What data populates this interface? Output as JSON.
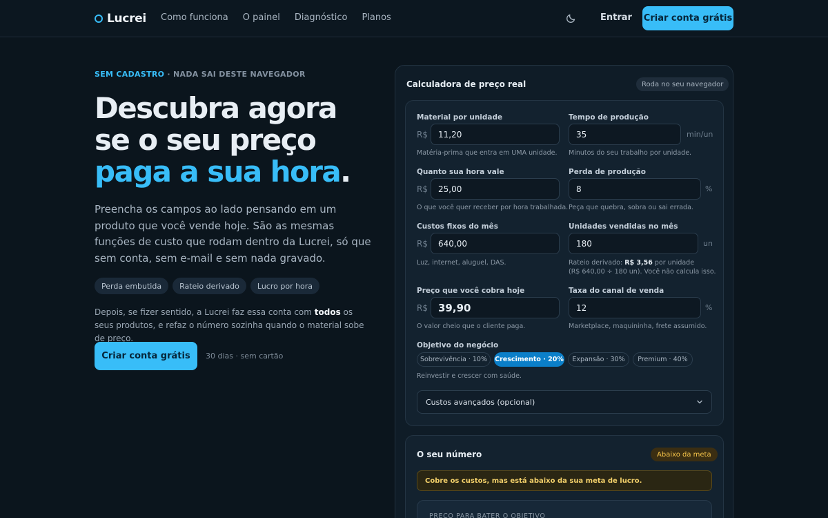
{
  "brand": {
    "name": "Lucrei",
    "accent": "#38bdf8"
  },
  "nav": {
    "links": [
      "Como funciona",
      "O painel",
      "Diagnóstico",
      "Planos"
    ],
    "theme_icon": "moon-icon",
    "login": "Entrar",
    "cta": "Criar conta grátis"
  },
  "hero": {
    "eyebrow_a": "SEM CADASTRO",
    "eyebrow_b": " · NADA SAI DESTE NAVEGADOR",
    "line1": "Descubra agora",
    "line2": "se o seu preço",
    "line3": "paga a sua hora",
    "line3_dot": ".",
    "lead": "Preencha os campos ao lado pensando em um produto que você vende hoje. São as mesmas funções de custo que rodam dentro da Lucrei, só que sem conta, sem e-mail e sem nada gravado.",
    "chips": [
      "Perda embutida",
      "Rateio derivado",
      "Lucro por hora"
    ],
    "after_a": "Depois, se fizer sentido, a Lucrei faz essa conta com ",
    "after_b": "todos",
    "after_c": " os seus produtos, e refaz o número sozinha quando o material sobe de preço.",
    "cta": "Criar conta grátis",
    "cta_note": "30 dias · sem cartão"
  },
  "calculator": {
    "title": "Calculadora de preço real",
    "badge": "Roda no seu navegador",
    "currency": "R$",
    "fields": {
      "material": {
        "label": "Material por unidade",
        "value": "11,20",
        "help": "Matéria-prima que entra em UMA unidade."
      },
      "tempo": {
        "label": "Tempo de produção",
        "value": "35",
        "unit": "min/un",
        "help": "Minutos do seu trabalho por unidade."
      },
      "hora": {
        "label": "Quanto sua hora vale",
        "value": "25,00",
        "help": "O que você quer receber por hora trabalhada."
      },
      "perda": {
        "label": "Perda de produção",
        "value": "8",
        "unit": "%",
        "help": "Peça que quebra, sobra ou sai errada."
      },
      "fixos": {
        "label": "Custos fixos do mês",
        "value": "640,00",
        "help": "Luz, internet, aluguel, DAS."
      },
      "unidades": {
        "label": "Unidades vendidas no mês",
        "value": "180",
        "unit": "un",
        "help_a": "Rateio derivado: ",
        "help_b": "R$ 3,56",
        "help_c": " por unidade",
        "help_d": "(R$ 640,00 ÷ 180 un). Você não calcula isso."
      },
      "preco": {
        "label": "Preço que você cobra hoje",
        "value": "39,90",
        "help": "O valor cheio que o cliente paga."
      },
      "taxa": {
        "label": "Taxa do canal de venda",
        "value": "12",
        "unit": "%",
        "help": "Marketplace, maquininha, frete assumido."
      }
    },
    "objective": {
      "label": "Objetivo do negócio",
      "options": [
        "Sobrevivência · 10%",
        "Crescimento · 20%",
        "Expansão · 30%",
        "Premium · 40%"
      ],
      "selected": "Crescimento · 20%",
      "help": "Reinvestir e crescer com saúde."
    },
    "advanced": {
      "label": "Custos avançados (opcional)",
      "icon": "chevron-down-icon"
    }
  },
  "result": {
    "title": "O seu número",
    "badge": "Abaixo da meta",
    "warning": "Cobre os custos, mas está abaixo da sua meta de lucro.",
    "inner_label": "PREÇO PARA BATER O OBJETIVO"
  }
}
